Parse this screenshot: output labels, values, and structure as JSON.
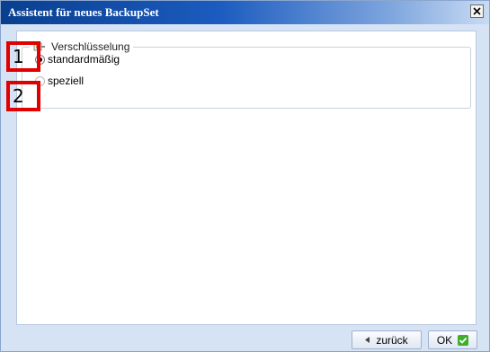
{
  "dialog": {
    "title": "Assistent für neues BackupSet",
    "close_icon": "close-icon"
  },
  "section": {
    "legend": "Verschlüsselung",
    "legend_icon": "encryption-key-icon",
    "options": [
      {
        "label": "standardmäßig",
        "selected": true
      },
      {
        "label": "speziell",
        "selected": false
      }
    ]
  },
  "annotations": {
    "markers": [
      "1",
      "2"
    ],
    "color": "#e00000"
  },
  "footer": {
    "back_label": "zurück",
    "back_icon": "arrow-left-icon",
    "ok_label": "OK",
    "ok_icon": "green-check-icon"
  }
}
